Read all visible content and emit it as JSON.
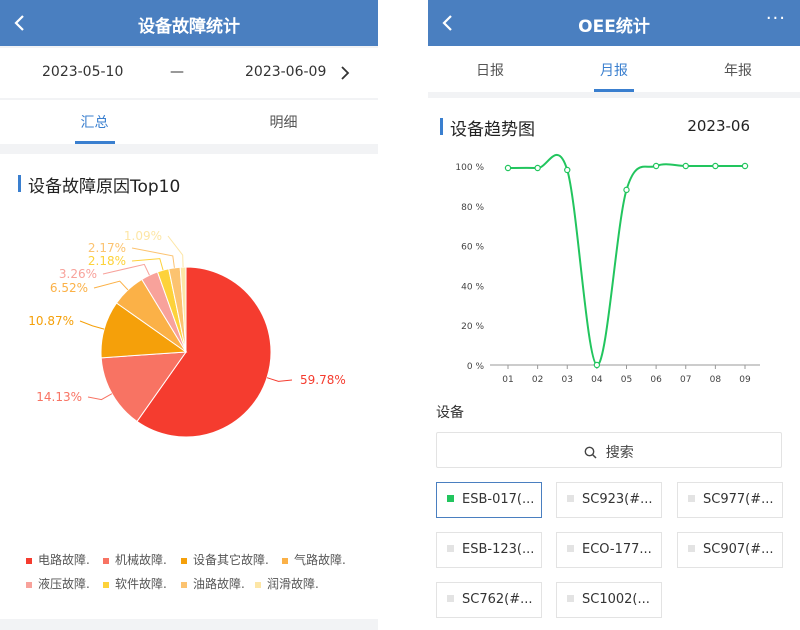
{
  "left": {
    "header": {
      "title": "设备故障统计"
    },
    "dates": {
      "start": "2023-05-10",
      "separator": "—",
      "end": "2023-06-09"
    },
    "tabs": [
      {
        "label": "汇总",
        "active": true
      },
      {
        "label": "明细",
        "active": false
      }
    ],
    "section_title": "设备故障原因Top10",
    "chart_data": {
      "type": "pie",
      "slices": [
        {
          "label": "电路故障.",
          "value": 59.78,
          "color": "#f53c2f"
        },
        {
          "label": "机械故障.",
          "value": 14.13,
          "color": "#f87363"
        },
        {
          "label": "设备其它故障.",
          "value": 10.87,
          "color": "#f5a00a"
        },
        {
          "label": "气路故障.",
          "value": 6.52,
          "color": "#fbb147"
        },
        {
          "label": "液压故障.",
          "value": 3.26,
          "color": "#f8a29b"
        },
        {
          "label": "软件故障.",
          "value": 2.18,
          "color": "#fdd23a"
        },
        {
          "label": "油路故障.",
          "value": 2.17,
          "color": "#fcc370"
        },
        {
          "label": "润滑故障.",
          "value": 1.09,
          "color": "#fde6a6"
        }
      ],
      "value_labels": [
        "59.78%",
        "14.13%",
        "10.87%",
        "6.52%",
        "3.26%",
        "2.18%",
        "2.17%",
        "1.09%"
      ]
    }
  },
  "right": {
    "header": {
      "title": "OEE统计",
      "more": "···"
    },
    "tabs": [
      {
        "label": "日报",
        "active": false
      },
      {
        "label": "月报",
        "active": true
      },
      {
        "label": "年报",
        "active": false
      }
    ],
    "section_title": "设备趋势图",
    "period": "2023-06",
    "chart_data": {
      "type": "line",
      "x": [
        "01",
        "02",
        "03",
        "04",
        "05",
        "06",
        "07",
        "08",
        "09"
      ],
      "series": [
        {
          "values": [
            99,
            99,
            98,
            0,
            88,
            100,
            100,
            100,
            100
          ],
          "color": "#22c55e"
        }
      ],
      "ylim": [
        0,
        100
      ],
      "yticks": [
        "0 %",
        "20 %",
        "40 %",
        "60 %",
        "80 %",
        "100 %"
      ],
      "ytick_values": [
        0,
        20,
        40,
        60,
        80,
        100
      ]
    },
    "devices_label": "设备",
    "search_label": "搜索",
    "devices": [
      "ESB-017(...",
      "SC923(#...",
      "SC977(#...",
      "ESB-123(...",
      "ECO-177...",
      "SC907(#...",
      "SC762(#...",
      "SC1002(..."
    ]
  }
}
